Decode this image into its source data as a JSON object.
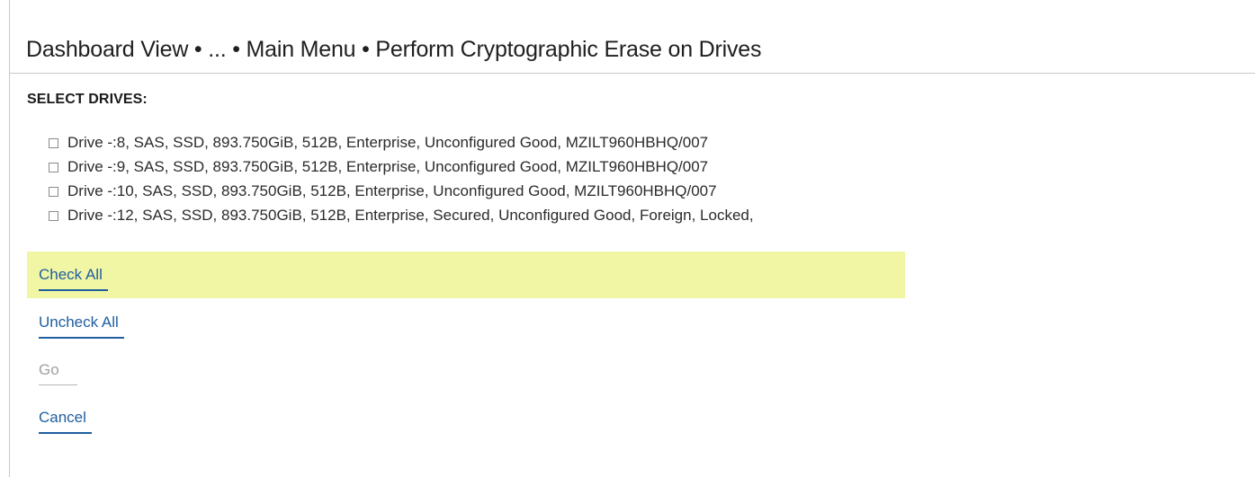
{
  "breadcrumb": {
    "text": "Dashboard View • ... • Main Menu • Perform Cryptographic Erase on Drives"
  },
  "section": {
    "label": "SELECT DRIVES:"
  },
  "drives": [
    {
      "label": "Drive -:8, SAS, SSD, 893.750GiB, 512B, Enterprise, Unconfigured Good, MZILT960HBHQ/007",
      "checked": false
    },
    {
      "label": "Drive -:9, SAS, SSD, 893.750GiB, 512B, Enterprise, Unconfigured Good, MZILT960HBHQ/007",
      "checked": false
    },
    {
      "label": "Drive -:10, SAS, SSD, 893.750GiB, 512B, Enterprise, Unconfigured Good, MZILT960HBHQ/007",
      "checked": false
    },
    {
      "label": "Drive -:12, SAS, SSD, 893.750GiB, 512B, Enterprise, Secured, Unconfigured Good, Foreign, Locked,",
      "checked": false
    }
  ],
  "actions": {
    "check_all": "Check All",
    "uncheck_all": "Uncheck All",
    "go": "Go",
    "cancel": "Cancel"
  },
  "colors": {
    "link": "#1f5fa0",
    "disabled": "#a0a0a0",
    "highlight": "#f1f6a4"
  }
}
